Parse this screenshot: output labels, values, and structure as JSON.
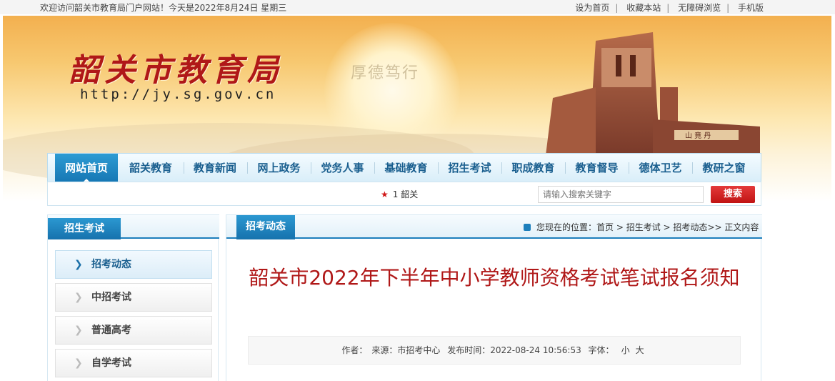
{
  "topbar": {
    "welcome": "欢迎访问韶关市教育局门户网站！今天是2022年8月24日 星期三",
    "links": [
      "设为首页",
      "收藏本站",
      "无障碍浏览",
      "手机版"
    ]
  },
  "banner": {
    "logo": "韶关市教育局",
    "url": "http://jy.sg.gov.cn",
    "motto": "厚德笃行"
  },
  "nav": {
    "items": [
      "网站首页",
      "韶关教育",
      "教育新闻",
      "网上政务",
      "党务人事",
      "基础教育",
      "招生考试",
      "职成教育",
      "教育督导",
      "德体卫艺",
      "教研之窗"
    ]
  },
  "search": {
    "hot": "1 韶关",
    "placeholder": "请输入搜索关键字",
    "button": "搜索"
  },
  "sidebar": {
    "title": "招生考试",
    "items": [
      "招考动态",
      "中招考试",
      "普通高考",
      "自学考试"
    ]
  },
  "main": {
    "tab": "招考动态",
    "breadcrumb": {
      "label": "您现在的位置：",
      "path": [
        "首页",
        "招生考试",
        "招考动态"
      ],
      "current": "正文内容"
    },
    "title": "韶关市2022年下半年中小学教师资格考试笔试报名须知",
    "meta": {
      "author": "作者：",
      "source": "来源：市招考中心",
      "time": "发布时间：2022-08-24 10:56:53",
      "font_label": "字体：",
      "small": "小",
      "large": "大"
    }
  },
  "colors": {
    "accent": "#1d7fbc",
    "title_red": "#b01818",
    "button_red": "#c11414"
  }
}
